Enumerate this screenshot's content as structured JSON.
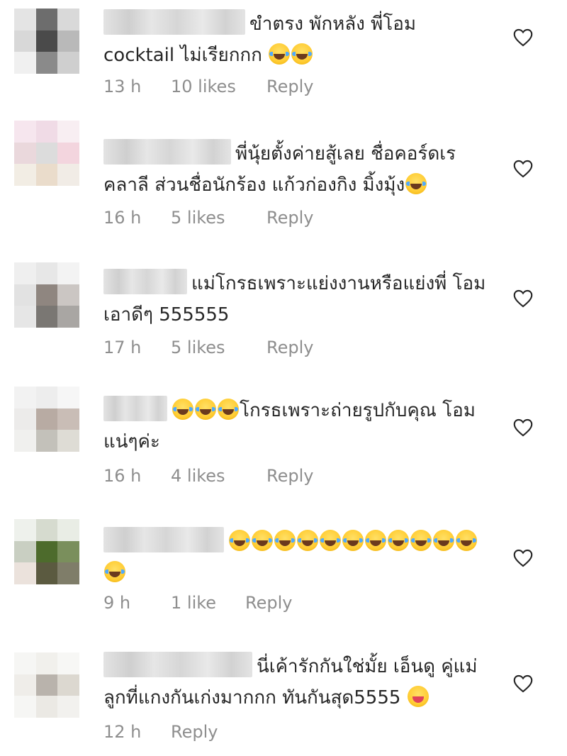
{
  "comments": [
    {
      "text": "ขำตรง พักหลัง พี่โอม cocktail ไม่เรียกกก",
      "emojis": [
        "face-with-tears-of-joy",
        "face-with-tears-of-joy"
      ],
      "time": "13 h",
      "likes": "10 likes",
      "reply": "Reply"
    },
    {
      "text": "พี่นุ้ยตั้งค่ายสู้เลย ชื่อคอร์ดเร คลาลี ส่วนชื่อนักร้อง แก้วก่องกิง มิ้งมุ้ง",
      "emojis": [
        "face-with-tears-of-joy"
      ],
      "time": "16 h",
      "likes": "5 likes",
      "reply": "Reply"
    },
    {
      "text": "แม่โกรธเพราะแย่งงานหรือแย่งพี่ โอม เอาดีๆ 555555",
      "emojis": [],
      "time": "17 h",
      "likes": "5 likes",
      "reply": "Reply"
    },
    {
      "text": "โกรธเพราะถ่ายรูปกับคุณ โอมแน่ๆค่ะ",
      "emojis": [
        "face-with-tears-of-joy",
        "face-with-tears-of-joy",
        "face-with-tears-of-joy"
      ],
      "time": "16 h",
      "likes": "4 likes",
      "reply": "Reply"
    },
    {
      "text": "",
      "emojis": [
        "face-with-tears-of-joy",
        "face-with-tears-of-joy",
        "face-with-tears-of-joy",
        "face-with-tears-of-joy",
        "face-with-tears-of-joy",
        "face-with-tears-of-joy",
        "face-with-tears-of-joy",
        "face-with-tears-of-joy",
        "face-with-tears-of-joy",
        "face-with-tears-of-joy",
        "face-with-tears-of-joy",
        "face-with-tears-of-joy"
      ],
      "time": "9 h",
      "likes": "1 like",
      "reply": "Reply"
    },
    {
      "text": "นี่เค้ารักกันใช่มั้ย เอ็นดู คู่แม่ลูกที่แกงกันเก่งมากกก ทันกันสุด5555",
      "emojis": [
        "squinting-face-with-tongue"
      ],
      "time": "12 h",
      "likes": "",
      "reply": "Reply"
    }
  ],
  "colors": {
    "meta_text": "#8e8e8e",
    "body_text": "#262626",
    "heart_outline": "#262626"
  }
}
